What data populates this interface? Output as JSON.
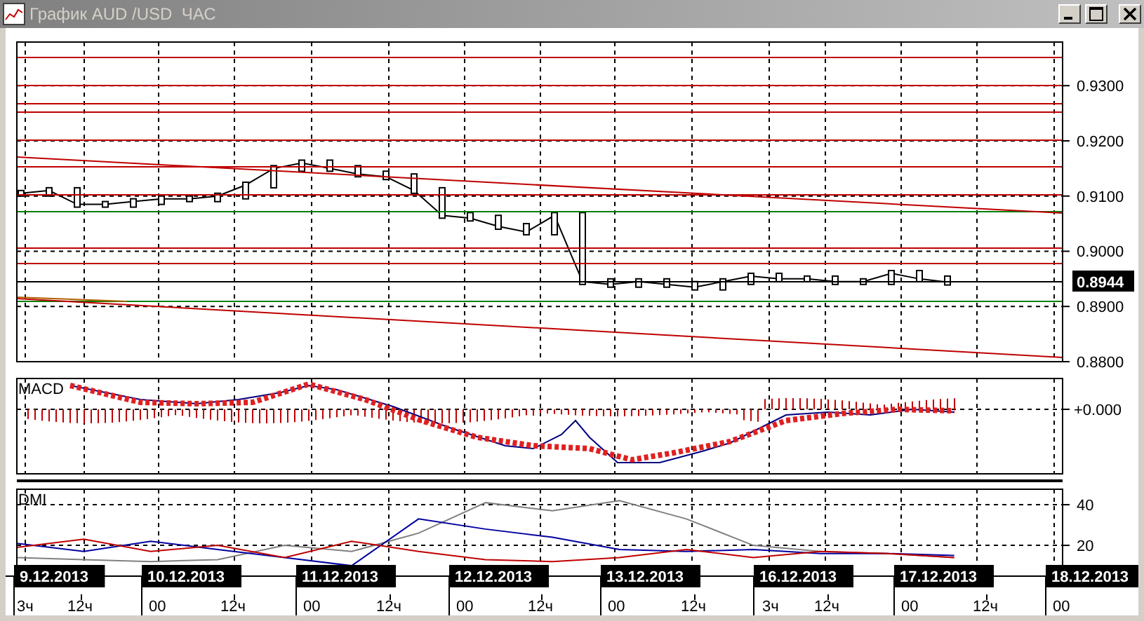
{
  "window": {
    "title": "График AUD /USD  ЧАС"
  },
  "price_panel": {
    "current_price": "0.8944",
    "chart_data": {
      "type": "line",
      "grid": true,
      "ylim": [
        0.88,
        0.9379
      ],
      "yticks": [
        {
          "value": 0.88,
          "label": "0.8800"
        },
        {
          "value": 0.89,
          "label": "0.8900"
        },
        {
          "value": 0.9,
          "label": "0.9000"
        },
        {
          "value": 0.91,
          "label": "0.9100"
        },
        {
          "value": 0.92,
          "label": "0.9200"
        },
        {
          "value": 0.93,
          "label": "0.9300"
        }
      ],
      "series": [
        {
          "color": "#000000",
          "values": [
            0.9105,
            0.911,
            0.9085,
            0.9085,
            0.909,
            0.9095,
            0.9095,
            0.91,
            0.912,
            0.915,
            0.916,
            0.915,
            0.914,
            0.9135,
            0.911,
            0.9065,
            0.906,
            0.9045,
            0.9035,
            0.9065,
            0.8945,
            0.894,
            0.8945,
            0.894,
            0.8935,
            0.8945,
            0.8955,
            0.895,
            0.895,
            0.8945,
            0.8945,
            0.896,
            0.895,
            0.8944
          ]
        }
      ]
    }
  },
  "macd_panel": {
    "label": "MACD",
    "zero_label": "+0.000"
  },
  "dmi_panel": {
    "label": "DMI",
    "chart_data": {
      "type": "line",
      "grid": true,
      "ylim": [
        9,
        47.6
      ],
      "yticks": [
        {
          "value": 20,
          "label": "20"
        },
        {
          "value": 40,
          "label": "40"
        }
      ],
      "series": [
        {
          "color": "#808080",
          "values": [
            14,
            13,
            12,
            13,
            20,
            17,
            26,
            41,
            37,
            42,
            33,
            20,
            17,
            16,
            14
          ]
        },
        {
          "color": "#0000a0",
          "values": [
            21,
            17,
            22,
            18,
            14,
            10,
            33,
            28,
            24,
            18,
            17,
            18,
            16,
            16,
            15
          ]
        },
        {
          "color": "#c00000",
          "values": [
            19,
            23,
            17,
            20,
            14,
            22,
            17,
            13,
            12,
            14,
            18,
            14,
            17,
            16,
            14
          ]
        }
      ]
    }
  },
  "time_axis": {
    "days": [
      {
        "date": "9.12.2013",
        "hours": [
          "3ч",
          "12ч"
        ]
      },
      {
        "date": "10.12.2013",
        "hours": [
          "00",
          "12ч"
        ]
      },
      {
        "date": "11.12.2013",
        "hours": [
          "00",
          "12ч"
        ]
      },
      {
        "date": "12.12.2013",
        "hours": [
          "00",
          "12ч"
        ]
      },
      {
        "date": "13.12.2013",
        "hours": [
          "00",
          "12ч"
        ]
      },
      {
        "date": "16.12.2013",
        "hours": [
          "3ч",
          "12ч"
        ]
      },
      {
        "date": "17.12.2013",
        "hours": [
          "00",
          "12ч"
        ]
      },
      {
        "date": "18.12.2013",
        "hours": [
          "00"
        ]
      }
    ]
  }
}
